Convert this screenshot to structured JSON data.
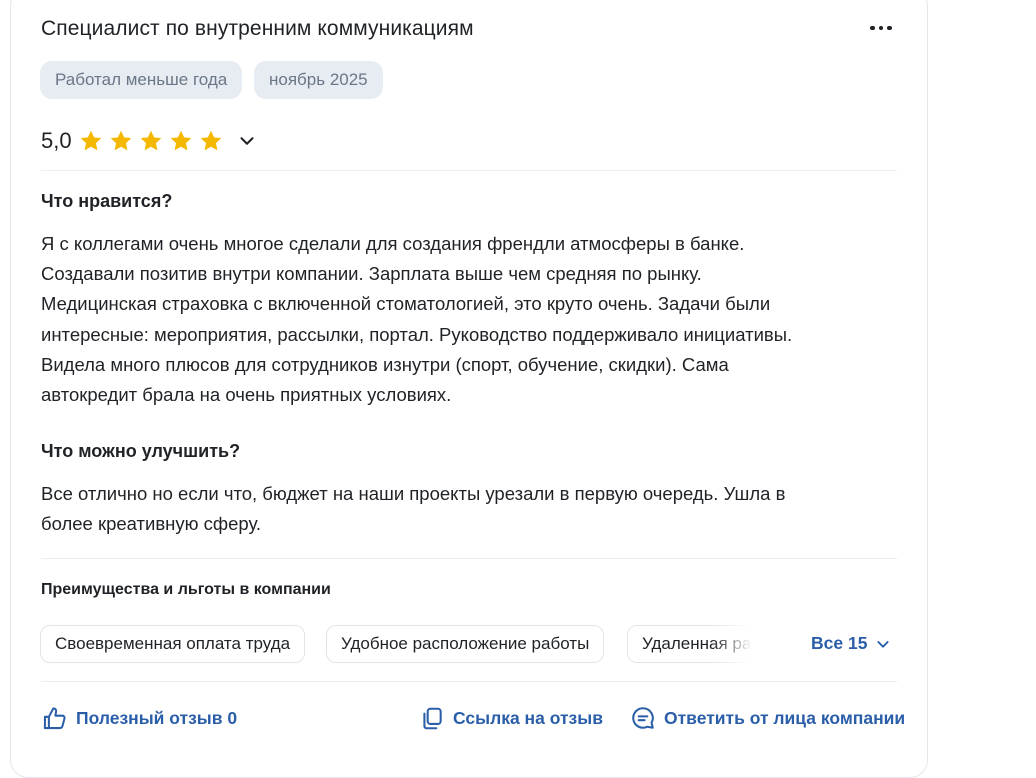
{
  "review": {
    "title": "Специалист по внутренним коммуникациям",
    "tags": [
      "Работал меньше года",
      "ноябрь 2025"
    ],
    "rating": {
      "value_label": "5,0",
      "stars": 5,
      "max": 5
    },
    "pros": {
      "heading": "Что нравится?",
      "lines": [
        "Я с коллегами очень многое сделали для создания френдли атмосферы в банке.",
        "Создавали позитив внутри компании. Зарплата выше чем средняя по рынку.",
        "Медицинская страховка с включенной стоматологией, это круто очень. Задачи были",
        "интересные: мероприятия, рассылки, портал. Руководство поддерживало инициативы.",
        "Видела много плюсов для сотрудников изнутри (спорт, обучение, скидки). Сама",
        "автокредит брала на очень приятных условиях."
      ]
    },
    "cons": {
      "heading": "Что можно улучшить?",
      "lines": [
        "Все отлично но если что, бюджет на наши проекты урезали в первую очередь. Ушла в",
        "более креативную сферу."
      ]
    },
    "benefits": {
      "heading": "Преимущества и льготы в компании",
      "chips": [
        "Своевременная оплата труда",
        "Удобное расположение работы",
        "Удаленная работа"
      ],
      "all_label": "Все 15"
    },
    "actions": {
      "useful_label": "Полезный отзыв 0",
      "link_label": "Ссылка на отзыв",
      "reply_label": "Ответить от лица компании"
    },
    "icons": {
      "more": "more-dots-icon",
      "star": "star-icon",
      "chevron": "chevron-down-icon",
      "thumb": "thumbs-up-icon",
      "copy": "copy-link-icon",
      "reply": "chat-bubble-icon"
    },
    "colors": {
      "star": "#f5b800",
      "link": "#2b5ea8",
      "tag_bg": "#e7ecf3",
      "tag_text": "#6b7686"
    }
  }
}
